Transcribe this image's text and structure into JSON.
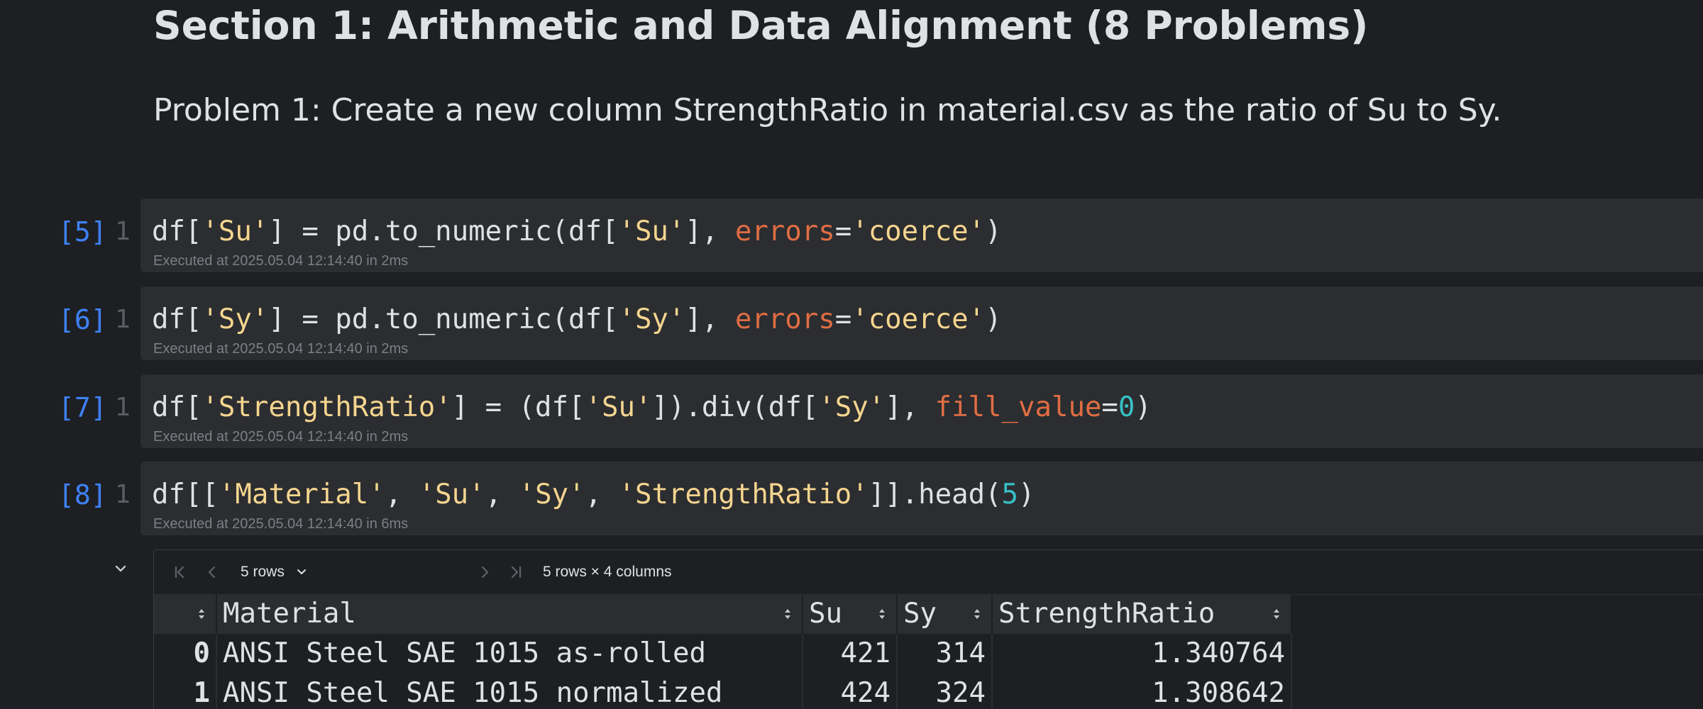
{
  "section": {
    "heading": "Section 1: Arithmetic and Data Alignment (8 Problems)",
    "problem": "Problem 1: Create a new column StrengthRatio in material.csv as the ratio of Su to Sy."
  },
  "cells": [
    {
      "exec_count": "[5]",
      "line_number": "1",
      "code_tokens": [
        {
          "t": "df[",
          "c": "plain"
        },
        {
          "t": "'Su'",
          "c": "str"
        },
        {
          "t": "] = pd.to_numeric(df[",
          "c": "plain"
        },
        {
          "t": "'Su'",
          "c": "str"
        },
        {
          "t": "], ",
          "c": "plain"
        },
        {
          "t": "errors",
          "c": "kw"
        },
        {
          "t": "=",
          "c": "plain"
        },
        {
          "t": "'coerce'",
          "c": "str"
        },
        {
          "t": ")",
          "c": "plain"
        }
      ],
      "executed": "Executed at 2025.05.04 12:14:40 in 2ms"
    },
    {
      "exec_count": "[6]",
      "line_number": "1",
      "code_tokens": [
        {
          "t": "df[",
          "c": "plain"
        },
        {
          "t": "'Sy'",
          "c": "str"
        },
        {
          "t": "] = pd.to_numeric(df[",
          "c": "plain"
        },
        {
          "t": "'Sy'",
          "c": "str"
        },
        {
          "t": "], ",
          "c": "plain"
        },
        {
          "t": "errors",
          "c": "kw"
        },
        {
          "t": "=",
          "c": "plain"
        },
        {
          "t": "'coerce'",
          "c": "str"
        },
        {
          "t": ")",
          "c": "plain"
        }
      ],
      "executed": "Executed at 2025.05.04 12:14:40 in 2ms"
    },
    {
      "exec_count": "[7]",
      "line_number": "1",
      "code_tokens": [
        {
          "t": "df[",
          "c": "plain"
        },
        {
          "t": "'StrengthRatio'",
          "c": "str"
        },
        {
          "t": "] = (df[",
          "c": "plain"
        },
        {
          "t": "'Su'",
          "c": "str"
        },
        {
          "t": "]).div(df[",
          "c": "plain"
        },
        {
          "t": "'Sy'",
          "c": "str"
        },
        {
          "t": "], ",
          "c": "plain"
        },
        {
          "t": "fill_value",
          "c": "kw"
        },
        {
          "t": "=",
          "c": "plain"
        },
        {
          "t": "0",
          "c": "num"
        },
        {
          "t": ")",
          "c": "plain"
        }
      ],
      "executed": "Executed at 2025.05.04 12:14:40 in 2ms"
    },
    {
      "exec_count": "[8]",
      "line_number": "1",
      "code_tokens": [
        {
          "t": "df[[",
          "c": "plain"
        },
        {
          "t": "'Material'",
          "c": "str"
        },
        {
          "t": ", ",
          "c": "plain"
        },
        {
          "t": "'Su'",
          "c": "str"
        },
        {
          "t": ", ",
          "c": "plain"
        },
        {
          "t": "'Sy'",
          "c": "str"
        },
        {
          "t": ", ",
          "c": "plain"
        },
        {
          "t": "'StrengthRatio'",
          "c": "str"
        },
        {
          "t": "]].head(",
          "c": "plain"
        },
        {
          "t": "5",
          "c": "num"
        },
        {
          "t": ")",
          "c": "plain"
        }
      ],
      "executed": "Executed at 2025.05.04 12:14:40 in 6ms"
    }
  ],
  "output": {
    "toolbar": {
      "icons": [
        "first-page-icon",
        "prev-page-icon",
        "next-page-icon",
        "last-page-icon"
      ],
      "rows_select": "5 rows",
      "info": "5 rows × 4 columns"
    },
    "table": {
      "headers": [
        "Material",
        "Su",
        "Sy",
        "StrengthRatio"
      ],
      "rows": [
        {
          "index": "0",
          "cells": [
            "ANSI Steel SAE 1015 as-rolled",
            "421",
            "314",
            "1.340764"
          ]
        },
        {
          "index": "1",
          "cells": [
            "ANSI Steel SAE 1015 normalized",
            "424",
            "324",
            "1.308642"
          ]
        }
      ]
    }
  },
  "colors": {
    "background": "#1e1f22",
    "cell_background": "#2b2d30",
    "exec_count": "#3e82f7",
    "string": "#f5d58f",
    "keyword_arg": "#e06d43",
    "number": "#37c0c6"
  }
}
